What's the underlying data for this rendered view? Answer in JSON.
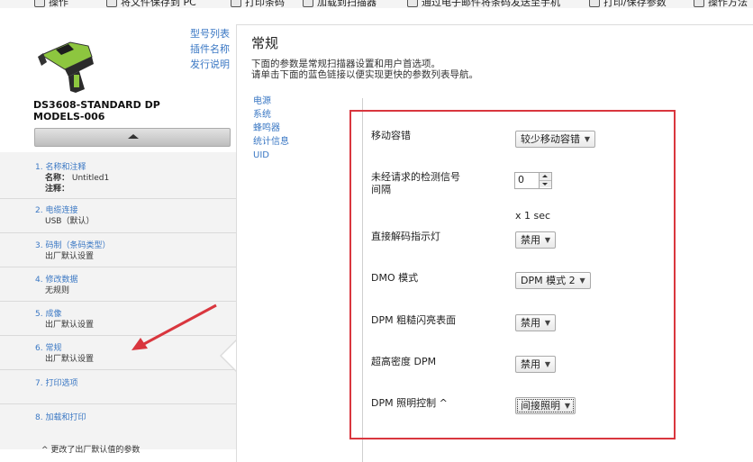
{
  "toolbar": {
    "items": [
      {
        "label": "操作",
        "icon": "gear-icon"
      },
      {
        "label": "将文件保存到 PC",
        "icon": "save-icon"
      },
      {
        "label": "打印条码",
        "icon": "print-icon"
      },
      {
        "label": "加载到扫描器",
        "icon": "load-icon"
      },
      {
        "label": "通过电子邮件将条码发送至手机",
        "icon": "email-icon"
      },
      {
        "label": "打印/保存参数",
        "icon": "print-save-icon"
      },
      {
        "label": "操作方法",
        "icon": "help-icon"
      }
    ]
  },
  "device": {
    "model": "DS3608-STANDARD DP MODELS-006",
    "links": [
      "型号列表",
      "插件名称",
      "发行说明"
    ]
  },
  "steps": [
    {
      "title": "1.  名称和注释",
      "lines": [
        {
          "key": "名称：",
          "value": "Untitled1"
        },
        {
          "key": "注释：",
          "value": ""
        }
      ]
    },
    {
      "title": "2.  电缆连接",
      "sub": "USB（默认）"
    },
    {
      "title": "3.  码制（条码类型）",
      "sub": "出厂默认设置"
    },
    {
      "title": "4.  修改数据",
      "sub": "无规则"
    },
    {
      "title": "5.  成像",
      "sub": "出厂默认设置"
    },
    {
      "title": "6.  常规",
      "sub": "出厂默认设置"
    },
    {
      "title": "7.  打印选项",
      "sub": ""
    },
    {
      "title": "8.  加载和打印",
      "sub": ""
    }
  ],
  "footnote": "^  更改了出厂默认值的参数",
  "main": {
    "title": "常规",
    "desc_line1": "下面的参数是常规扫描器设置和用户首选项。",
    "desc_line2": "请单击下面的蓝色链接以便实现更快的参数列表导航。",
    "nav": [
      "电源",
      "系统",
      "蜂鸣器",
      "统计信息",
      "UID"
    ]
  },
  "params": {
    "mobility": {
      "label": "移动容错",
      "value": "较少移动容错"
    },
    "interval": {
      "label_line1": "未经请求的检测信号",
      "label_line2": "间隔",
      "value": "0",
      "unit": "x 1 sec"
    },
    "direct_decode": {
      "label": "直接解码指示灯",
      "value": "禁用"
    },
    "dmo": {
      "label": "DMO 模式",
      "value": "DPM 模式 2"
    },
    "dpm_rough": {
      "label": "DPM 粗糙闪亮表面",
      "value": "禁用"
    },
    "ultra_density": {
      "label": "超高密度 DPM",
      "value": "禁用"
    },
    "dpm_lighting": {
      "label": "DPM 照明控制 ^",
      "value": "间接照明"
    }
  },
  "colors": {
    "link": "#3b78c4",
    "annotation_red": "#d9363e",
    "device_green": "#8dc63f"
  }
}
